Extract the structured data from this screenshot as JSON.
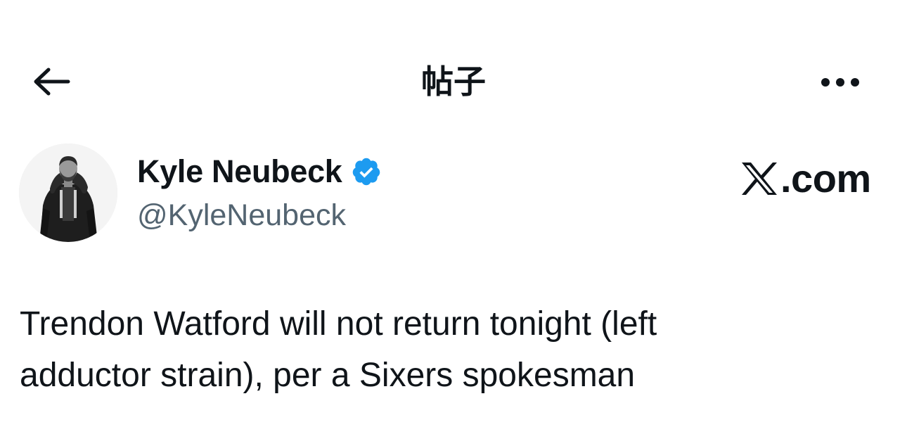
{
  "nav": {
    "title": "帖子",
    "back_icon": "arrow-left-icon",
    "more_icon": "more-horizontal-icon"
  },
  "author": {
    "display_name": "Kyle Neubeck",
    "handle": "@KyleNeubeck",
    "verified": true,
    "verified_color": "#1d9bf0"
  },
  "brand": {
    "text": ".com",
    "icon": "x-logo-icon"
  },
  "post": {
    "text_line1": "Trendon Watford will not return tonight (left",
    "text_line2": "adductor strain), per a Sixers spokesman"
  },
  "colors": {
    "text_primary": "#0f1419",
    "text_secondary": "#536471",
    "background": "#ffffff"
  }
}
